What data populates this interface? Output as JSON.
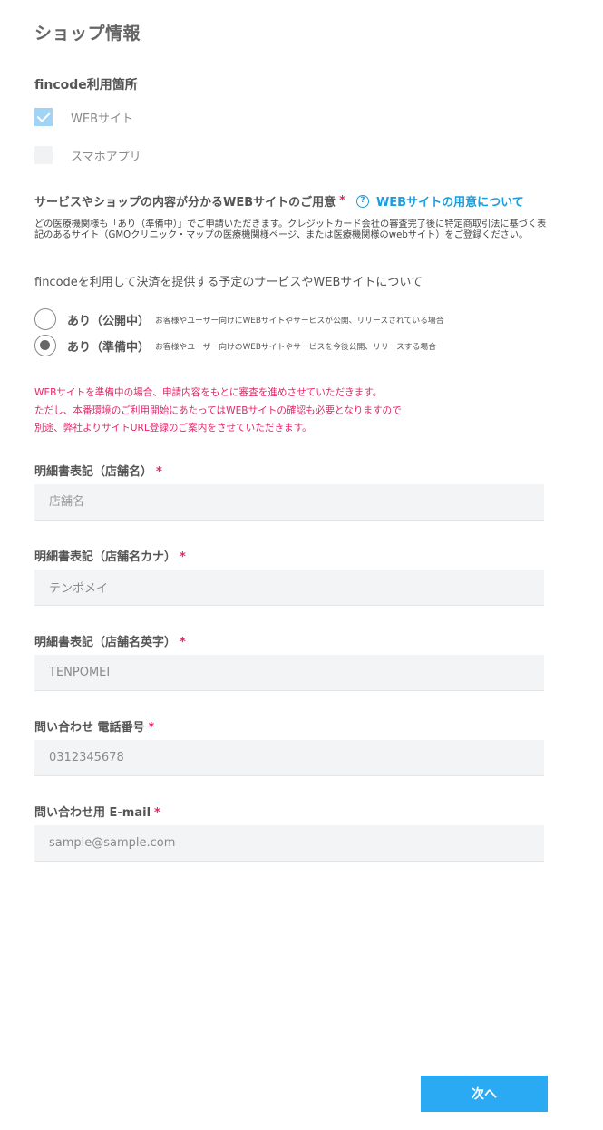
{
  "page": {
    "title": "ショップ情報"
  },
  "usage": {
    "label": "fincode利用箇所",
    "options": [
      {
        "label": "WEBサイト",
        "checked": true
      },
      {
        "label": "スマホアプリ",
        "checked": false
      }
    ]
  },
  "website": {
    "label": "サービスやショップの内容が分かるWEBサイトのご用意",
    "required_mark": "*",
    "help_icon_text": "?",
    "help_link": "WEBサイトの用意について",
    "note": "どの医療機関様も「あり（準備中）」でご申請いただきます。クレジットカード会社の審査完了後に特定商取引法に基づく表記のあるサイト（GMOクリニック・マップの医療機関様ページ、または医療機関様のwebサイト）をご登録ください。"
  },
  "service": {
    "question": "fincodeを利用して決済を提供する予定のサービスやWEBサイトについて",
    "options": [
      {
        "label": "あり（公開中）",
        "desc": "お客様やユーザー向けにWEBサイトやサービスが公開、リリースされている場合",
        "selected": false
      },
      {
        "label": "あり（準備中）",
        "desc": "お客様やユーザー向けのWEBサイトやサービスを今後公開、リリースする場合",
        "selected": true
      }
    ]
  },
  "warning": {
    "lines": [
      "WEBサイトを準備中の場合、申請内容をもとに審査を進めさせていただきます。",
      "ただし、本番環境のご利用開始にあたってはWEBサイトの確認も必要となりますので",
      "別途、弊社よりサイトURL登録のご案内をさせていただきます。"
    ]
  },
  "fields": [
    {
      "label": "明細書表記（店舗名）",
      "required_mark": "*",
      "placeholder": "店舗名",
      "value": ""
    },
    {
      "label": "明細書表記（店舗名カナ）",
      "required_mark": "*",
      "placeholder": "",
      "value": "テンポメイ"
    },
    {
      "label": "明細書表記（店舗名英字）",
      "required_mark": "*",
      "placeholder": "",
      "value": "TENPOMEI"
    },
    {
      "label": "問い合わせ 電話番号",
      "required_mark": "*",
      "placeholder": "",
      "value": "0312345678"
    },
    {
      "label": "問い合わせ用 E-mail",
      "required_mark": "*",
      "placeholder": "",
      "value": "sample@sample.com"
    }
  ],
  "actions": {
    "next_label": "次へ"
  },
  "colors": {
    "accent": "#2aaaf2",
    "required": "#e5266b",
    "link": "#1a9ee0"
  }
}
